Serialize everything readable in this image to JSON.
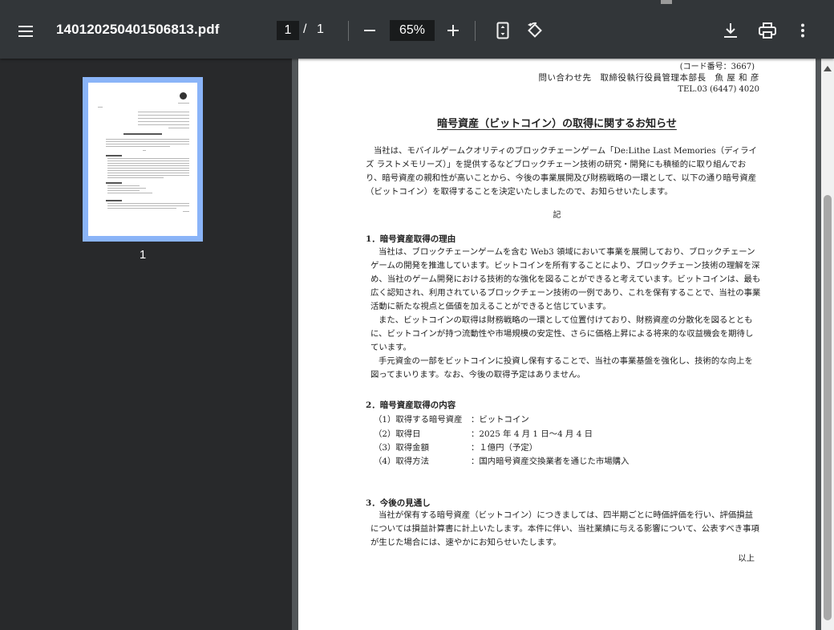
{
  "toolbar": {
    "file_name": "140120250401506813.pdf",
    "current_page": "1",
    "page_separator": "/",
    "total_pages": "1",
    "zoom_level": "65%",
    "icons": [
      "menu-icon",
      "minus-icon",
      "plus-icon",
      "fit-page-icon",
      "rotate-icon",
      "download-icon",
      "print-icon",
      "more-vert-icon"
    ]
  },
  "sidebar": {
    "thumbnails": [
      {
        "label": "1",
        "selected": true
      }
    ],
    "accent_color": "#8ab4f8"
  },
  "document": {
    "code_number": "(コード番号：3667)",
    "contact": "問い合わせ先　取締役執行役員管理本部長　魚 屋 和 彦",
    "tel": "TEL.03 (6447) 4020",
    "title": "暗号資産（ビットコイン）の取得に関するお知らせ",
    "intro": "当社は、モバイルゲームクオリティのブロックチェーンゲーム「De:Lithe Last Memories（ディライズ ラストメモリーズ）」を提供するなどブロックチェーン技術の研究・開発にも積極的に取り組んでおり、暗号資産の親和性が高いことから、今後の事業展開及び財務戦略の一環として、以下の通り暗号資産（ビットコイン）を取得することを決定いたしましたので、お知らせいたします。",
    "ki": "記",
    "section1": {
      "heading": "1．暗号資産取得の理由",
      "paragraphs": [
        "当社は、ブロックチェーンゲームを含む Web3 領域において事業を展開しており、ブロックチェーンゲームの開発を推進しています。ビットコインを所有することにより、ブロックチェーン技術の理解を深め、当社のゲーム開発における技術的な強化を図ることができると考えています。ビットコインは、最も広く認知され、利用されているブロックチェーン技術の一例であり、これを保有することで、当社の事業活動に新たな視点と価値を加えることができると信じています。",
        "また、ビットコインの取得は財務戦略の一環として位置付けており、財務資産の分散化を図るとともに、ビットコインが持つ流動性や市場規模の安定性、さらに価格上昇による将来的な収益機会を期待しています。",
        "手元資金の一部をビットコインに投資し保有することで、当社の事業基盤を強化し、技術的な向上を図ってまいります。なお、今後の取得予定はありません。"
      ]
    },
    "section2": {
      "heading": "2．暗号資産取得の内容",
      "items": [
        {
          "label": "（1）取得する暗号資産",
          "value": "：ビットコイン"
        },
        {
          "label": "（2）取得日",
          "value": "：2025 年 4 月 1 日～4 月 4 日"
        },
        {
          "label": "（3）取得金額",
          "value": "：１億円（予定）"
        },
        {
          "label": "（4）取得方法",
          "value": "：国内暗号資産交換業者を通じた市場購入"
        }
      ]
    },
    "section3": {
      "heading": "3．今後の見通し",
      "paragraphs": [
        "当社が保有する暗号資産（ビットコイン）につきましては、四半期ごとに時価評価を行い、評価損益については損益計算書に計上いたします。本件に伴い、当社業績に与える影響について、公表すべき事項が生じた場合には、速やかにお知らせいたします。"
      ]
    },
    "closing": "以上"
  }
}
